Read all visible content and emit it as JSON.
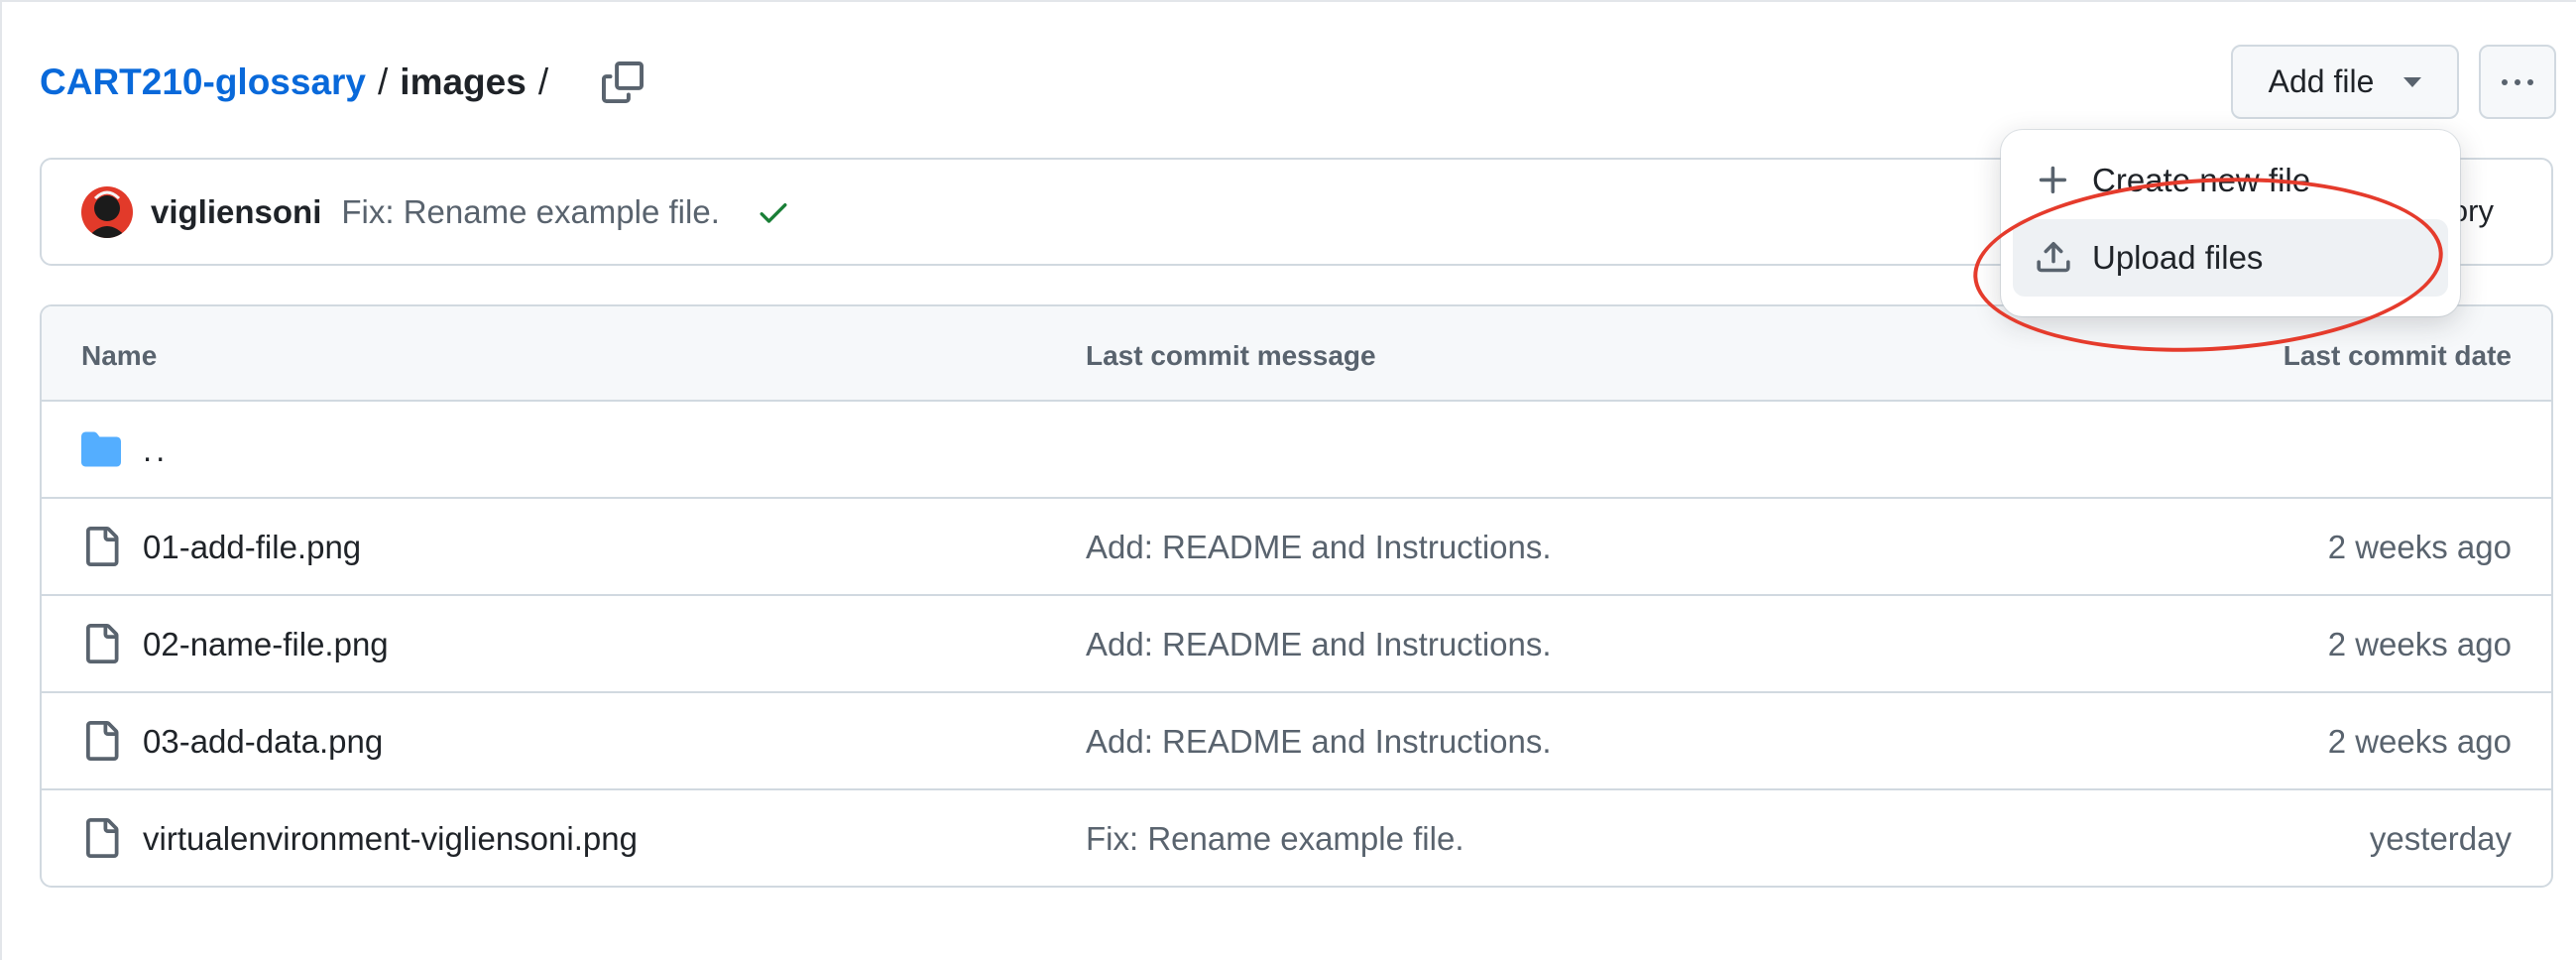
{
  "breadcrumb": {
    "repo": "CART210-glossary",
    "separator": "/",
    "current": "images",
    "trailing_separator": "/"
  },
  "actions": {
    "add_file_label": "Add file"
  },
  "commit": {
    "author": "vigliensoni",
    "message": "Fix: Rename example file.",
    "right_text": "ory",
    "status_color": "#1a7f37"
  },
  "table": {
    "columns": [
      "Name",
      "Last commit message",
      "Last commit date"
    ],
    "parent_label": "..",
    "rows": [
      {
        "name": "01-add-file.png",
        "message": "Add: README and Instructions.",
        "date": "2 weeks ago"
      },
      {
        "name": "02-name-file.png",
        "message": "Add: README and Instructions.",
        "date": "2 weeks ago"
      },
      {
        "name": "03-add-data.png",
        "message": "Add: README and Instructions.",
        "date": "2 weeks ago"
      },
      {
        "name": "virtualenvironment-vigliensoni.png",
        "message": "Fix: Rename example file.",
        "date": "yesterday"
      }
    ]
  },
  "dropdown": {
    "items": [
      {
        "label": "Create new file",
        "icon": "plus-icon"
      },
      {
        "label": "Upload files",
        "icon": "upload-icon"
      }
    ]
  },
  "colors": {
    "link": "#0969da",
    "annotation": "#e53b2c",
    "folder": "#54aeff"
  }
}
